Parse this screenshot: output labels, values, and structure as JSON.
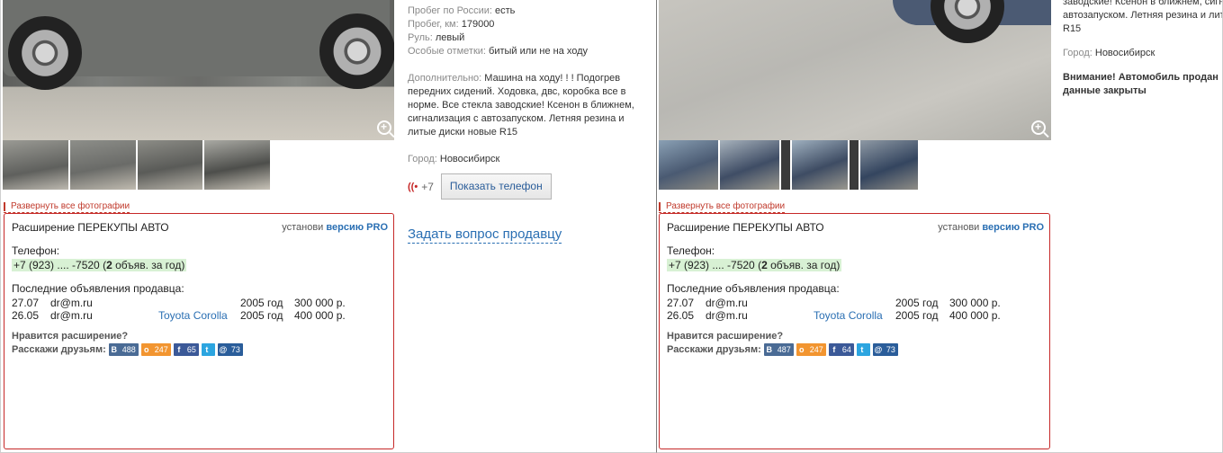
{
  "left": {
    "specs": [
      {
        "k": "Пробег по России:",
        "v": "есть"
      },
      {
        "k": "Пробег, км:",
        "v": "179000"
      },
      {
        "k": "Руль:",
        "v": "левый"
      },
      {
        "k": "Особые отметки:",
        "v": "битый или не на ходу"
      }
    ],
    "additional_label": "Дополнительно:",
    "additional_text": "Машина на ходу! ! ! Подогрев передних сидений. Ходовка, двс, коробка все в норме. Все стекла заводские! Ксенон в ближнем, сигнализация с автозапуском. Летняя резина и литые диски новые R15",
    "city_label": "Город:",
    "city": "Новосибирск",
    "phone_prefix": "+7",
    "show_phone": "Показать телефон",
    "ask_seller": "Задать вопрос продавцу",
    "expand_photos": "Развернуть все фотографии",
    "ext": {
      "title": "Расширение ПЕРЕКУПЫ АВТО",
      "install_prefix": "установи",
      "install_link": "версию PRO",
      "phone_label": "Телефон:",
      "phone_value": "+7 (923) .... -7520",
      "phone_count_open": " (",
      "phone_count_num": "2",
      "phone_count_rest": " объяв. за год)",
      "last_ads_label": "Последние объявления продавца:",
      "ads": [
        {
          "date": "27.07",
          "mail": "dr@m.ru",
          "model": "",
          "year": "2005 год",
          "price": "300 000 р."
        },
        {
          "date": "26.05",
          "mail": "dr@m.ru",
          "model": "Toyota Corolla",
          "year": "2005 год",
          "price": "400 000 р."
        }
      ],
      "like_q": "Нравится расширение?",
      "share_label": "Расскажи друзьям:",
      "share": {
        "vk": "488",
        "ok": "247",
        "fb": "65",
        "ml": "73"
      }
    }
  },
  "right": {
    "text_top": "заводские! Ксенон в ближнем, сигн автозапуском. Летняя резина и лит R15",
    "city_label": "Город:",
    "city": "Новосибирск",
    "warning": "Внимание! Автомобиль продан данные закрыты",
    "expand_photos": "Развернуть все фотографии",
    "ext": {
      "title": "Расширение ПЕРЕКУПЫ АВТО",
      "install_prefix": "установи",
      "install_link": "версию PRO",
      "phone_label": "Телефон:",
      "phone_value": "+7 (923) .... -7520",
      "phone_count_open": " (",
      "phone_count_num": "2",
      "phone_count_rest": " объяв. за год)",
      "last_ads_label": "Последние объявления продавца:",
      "ads": [
        {
          "date": "27.07",
          "mail": "dr@m.ru",
          "model": "",
          "year": "2005 год",
          "price": "300 000 р."
        },
        {
          "date": "26.05",
          "mail": "dr@m.ru",
          "model": "Toyota Corolla",
          "year": "2005 год",
          "price": "400 000 р."
        }
      ],
      "like_q": "Нравится расширение?",
      "share_label": "Расскажи друзьям:",
      "share": {
        "vk": "487",
        "ok": "247",
        "fb": "64",
        "ml": "73"
      }
    }
  },
  "icons": {
    "vk": "В",
    "ok": "о",
    "fb": "f",
    "tw": "t",
    "ml": "@"
  }
}
